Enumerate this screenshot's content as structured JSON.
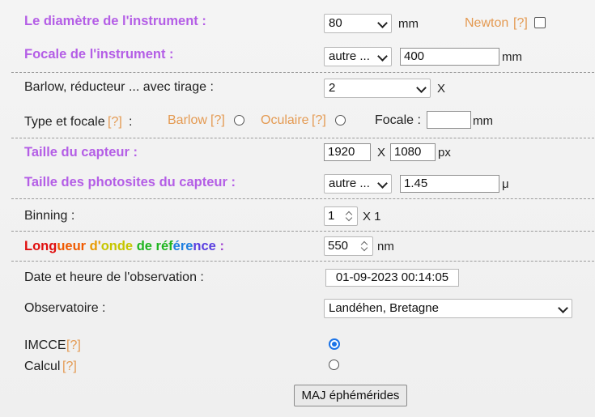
{
  "diameter": {
    "label": "Le diamètre de l'instrument :",
    "select_value": "80",
    "unit": "mm",
    "newton_label": "Newton",
    "newton_help": "[?]"
  },
  "focal": {
    "label": "Focale de l'instrument :",
    "select_value": "autre ...",
    "input_value": "400",
    "unit": "mm"
  },
  "barlow": {
    "label": "Barlow, réducteur ... avec tirage :",
    "select_value": "2",
    "unit": "X"
  },
  "type_focal": {
    "label": "Type et focale",
    "help": "[?]",
    "colon": ":",
    "barlow_label": "Barlow",
    "barlow_help": "[?]",
    "ocular_label": "Oculaire",
    "ocular_help": "[?]",
    "focal_label": "Focale :",
    "focal_value": "",
    "unit": "mm"
  },
  "sensor": {
    "label": "Taille du capteur :",
    "width": "1920",
    "sep": "X",
    "height": "1080",
    "unit": "px"
  },
  "photosites": {
    "label": "Taille des photosites du capteur :",
    "select_value": "autre ...",
    "input_value": "1.45",
    "unit": "μ"
  },
  "binning": {
    "label": "Binning :",
    "value": "1",
    "suffix": "X 1"
  },
  "wavelength": {
    "label_parts": [
      "Long",
      "ueur",
      " d'",
      "onde",
      " de ",
      "réf",
      "ére",
      "nce",
      " :"
    ],
    "value": "550",
    "unit": "nm"
  },
  "observation_date": {
    "label": "Date et heure de l'observation :",
    "value": "01-09-2023 00:14:05"
  },
  "observatory": {
    "label": "Observatoire :",
    "value": "Landéhen, Bretagne"
  },
  "ephemeris": {
    "imcce_label": "IMCCE",
    "imcce_help": "[?]",
    "calcul_label": "Calcul",
    "calcul_help": "[?]",
    "selected": "IMCCE",
    "button_label": "MAJ éphémérides"
  },
  "colors": {
    "purple_label": "#b45ee6",
    "orange_help": "#e49a52",
    "radio_selected": "#1a73e8",
    "wavelength_rainbow": [
      "#e01010",
      "#f05a00",
      "#e89a00",
      "#c6c600",
      "#1fb51f",
      "#1fb51f",
      "#1f7fe0",
      "#5a3fe0",
      "#a040d0"
    ]
  }
}
